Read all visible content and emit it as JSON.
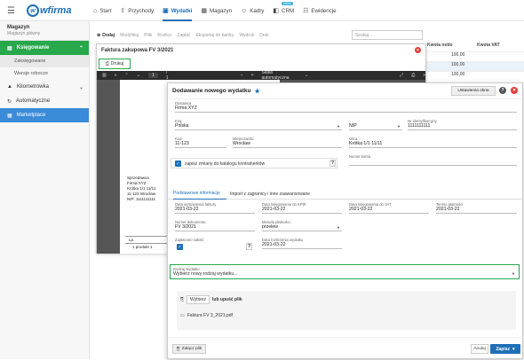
{
  "header": {
    "logo_text": "wfirma",
    "nav": [
      {
        "label": "Start",
        "icon": "home-icon"
      },
      {
        "label": "Przychody",
        "icon": "income-icon"
      },
      {
        "label": "Wydatki",
        "icon": "expenses-icon"
      },
      {
        "label": "Magazyn",
        "icon": "warehouse-icon"
      },
      {
        "label": "Kadry",
        "icon": "people-icon"
      },
      {
        "label": "CRM",
        "icon": "crm-icon",
        "badge": "NEW"
      },
      {
        "label": "Ewidencje",
        "icon": "register-icon"
      }
    ]
  },
  "sidebar": {
    "company_name": "Magazyn",
    "company_sub": "Magazyn główny",
    "section1": "Księgowanie",
    "sub1": "Zaksięgowane",
    "sub2": "Wersje robocze",
    "section2": "Kilometrówka",
    "section3": "Automatyczne",
    "section4": "Marketplace"
  },
  "toolbar": {
    "items": [
      "Dodaj",
      "Modyfikuj",
      "Pliki",
      "Rozlicz",
      "Zapłać",
      "Eksportuj do banku",
      "Wydruk",
      "Druk"
    ],
    "search_placeholder": "Szukaj..."
  },
  "table": {
    "headers": [
      "Kwota netto",
      "Kwota VAT"
    ],
    "rows": [
      [
        "",
        "100,00"
      ],
      [
        "",
        "100,00"
      ],
      [
        "",
        "100,00"
      ]
    ]
  },
  "invoice_window": {
    "title": "Faktura zakupowa FV 3/2021",
    "print_label": "Drukuj",
    "pdf": {
      "page_num": "1",
      "page_total": "/ 1",
      "zoom_label": "Skala automatyczna",
      "seller_lines": [
        "Sprzedawca",
        "Firma XYZ",
        "Krótka 1/1 11/11",
        "11-123 Wrocław",
        "NIP: 1111111111"
      ],
      "table_head": "Lp.",
      "table_cell": "1 produkt 1"
    }
  },
  "modal": {
    "title": "Dodawanie nowego wydatku",
    "settings_label": "Ustawienia okna",
    "contractor_label": "Dostawca",
    "contractor_value": "Firma XYZ",
    "country_label": "Kraj",
    "country_value": "Polska",
    "id_type_value": "NIP",
    "id_label": "Nr identyfikacyjny",
    "id_value": "1111111111",
    "zip_label": "Kod",
    "zip_value": "11-123",
    "city_label": "Miejscowość",
    "city_value": "Wrocław",
    "street_label": "Ulica",
    "street_value": "Krótka 1/1 11/11",
    "save_changes_label": "zapisz zmiany do katalogu kontrahentów",
    "account_label": "Numer konta",
    "tabs": [
      "Podstawowe informacje",
      "Import z zagranicy i inne zaawansowane"
    ],
    "issue_date_label": "Data wystawienia faktury",
    "issue_date": "2021-03-22",
    "kpir_date_label": "Data księgowania do KPiR",
    "kpir_date": "2021-03-22",
    "vat_date_label": "Data księgowania do VAT",
    "vat_date": "2021-03-22",
    "due_label": "Termin płatności",
    "due_date": "2021-03-22",
    "doc_number_label": "Numer dokumentu",
    "doc_number": "FV 3/2021",
    "payment_method_label": "Metoda płatności",
    "payment_method": "przelew",
    "paid_label": "Zapłacono całość",
    "settle_date_label": "Data rozliczenia wydatku",
    "settle_date": "2021-03-22",
    "expense_type_label": "Rodzaj wydatku",
    "expense_type_placeholder": "Wybierz nowy rodzaj wydatku...",
    "choose_label": "Wybierz",
    "drop_label": "lub upuść plik",
    "attached_file": "Faktura FV 3_2021.pdf",
    "attach_button": "Załącz plik",
    "cancel_button": "Anuluj",
    "save_button": "Zapisz"
  },
  "colors": {
    "accent": "#1e6fb8",
    "green": "#27a84a",
    "danger": "#e53935",
    "marketplace": "#3a8bd8"
  }
}
